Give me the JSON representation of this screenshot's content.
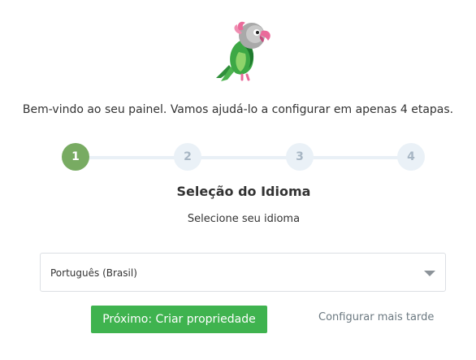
{
  "welcome_text": "Bem-vindo ao seu painel. Vamos ajudá-lo a configurar em apenas 4 etapas.",
  "logo": {
    "icon": "parrot-logo-icon"
  },
  "stepper": {
    "current": 1,
    "steps": [
      "1",
      "2",
      "3",
      "4"
    ],
    "active_color": "#78ab62",
    "inactive_color": "#eaf1f7"
  },
  "step_title": "Seleção do Idioma",
  "step_subtitle": "Selecione seu idioma",
  "language_select": {
    "value": "Português (Brasil)",
    "icon": "chevron-down-icon"
  },
  "actions": {
    "next_label": "Próximo: Criar propriedade",
    "later_label": "Configurar mais tarde",
    "primary_color": "#3fb34f"
  }
}
